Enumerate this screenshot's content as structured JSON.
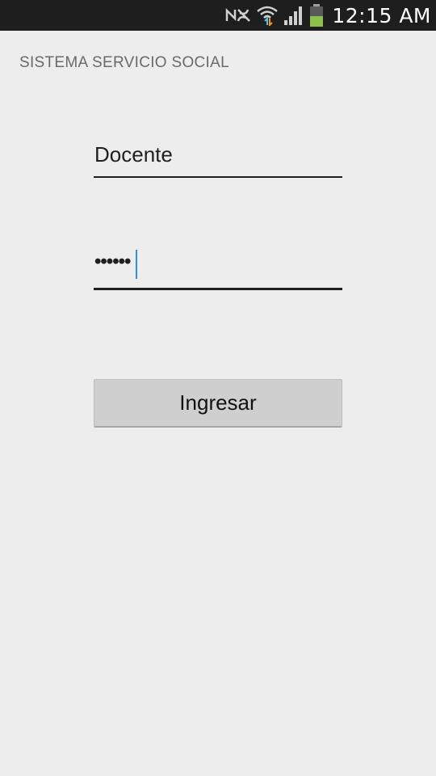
{
  "status_bar": {
    "time": "12:15 AM",
    "icons": [
      "nfc-icon",
      "wifi-icon",
      "signal-icon",
      "battery-icon"
    ],
    "background_color": "#1e1e1e",
    "battery_color": "#8bc34a"
  },
  "app": {
    "title": "SISTEMA SERVICIO SOCIAL"
  },
  "form": {
    "username_value": "Docente",
    "password_value": "••••••",
    "caret_color": "#2f8fd8",
    "submit_label": "Ingresar"
  }
}
